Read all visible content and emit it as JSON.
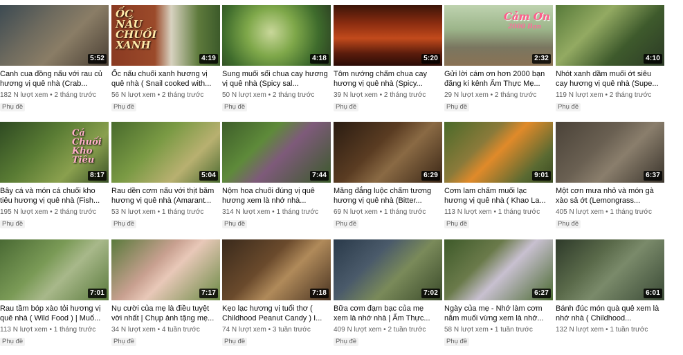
{
  "videos": [
    {
      "title": "Canh cua đồng nấu với rau củ hương vị quê nhà (Crab...",
      "views": "182 N lượt xem",
      "age": "2 tháng trước",
      "badge": "Phụ đề",
      "duration": "5:52"
    },
    {
      "title": "Ốc nấu chuối xanh hương vị quê nhà ( Snail cooked with...",
      "views": "56 N lượt xem",
      "age": "2 tháng trước",
      "badge": "Phụ đề",
      "duration": "4:19",
      "overlay": "ỐC NẤU CHUỐI XANH"
    },
    {
      "title": "Sung muối sổi chua cay hương vị quê nhà (Spicy sal...",
      "views": "50 N lượt xem",
      "age": "2 tháng trước",
      "badge": "Phụ đề",
      "duration": "4:18"
    },
    {
      "title": "Tôm nướng chấm chua cay hương vị quê nhà (Spicy...",
      "views": "39 N lượt xem",
      "age": "2 tháng trước",
      "badge": "Phụ đề",
      "duration": "5:20"
    },
    {
      "title": "Gửi lời cám ơn hơn 2000 bạn đăng kí kênh Ẩm Thực Mẹ...",
      "views": "29 N lượt xem",
      "age": "2 tháng trước",
      "badge": "Phụ đề",
      "duration": "2:32",
      "overlay": "Cảm Ơn",
      "overlay2": "2000 Bạn"
    },
    {
      "title": "Nhót xanh dầm muối ớt siêu cay hương vị quê nhà (Supe...",
      "views": "119 N lượt xem",
      "age": "2 tháng trước",
      "badge": "Phụ đề",
      "duration": "4:10"
    },
    {
      "title": "Bây cá và món cá chuối kho tiêu hương vị quê nhà (Fish...",
      "views": "195 N lượt xem",
      "age": "2 tháng trước",
      "badge": "Phụ đề",
      "duration": "8:17",
      "overlay": "Cá Chuối Kho Tiêu"
    },
    {
      "title": "Rau dền cơm nấu với thịt băm hương vị quê nhà (Amarant...",
      "views": "53 N lượt xem",
      "age": "1 tháng trước",
      "badge": "Phụ đề",
      "duration": "5:04"
    },
    {
      "title": "Nộm hoa chuối đúng vị quê hương xem là nhớ nhà...",
      "views": "314 N lượt xem",
      "age": "1 tháng trước",
      "badge": "Phụ đề",
      "duration": "7:44"
    },
    {
      "title": "Măng đắng luộc chấm tương hương vị quê nhà (Bitter...",
      "views": "69 N lượt xem",
      "age": "1 tháng trước",
      "badge": "Phụ đề",
      "duration": "6:29"
    },
    {
      "title": "Cơm lam chấm muối lạc hương vị quê nhà ( Khao La...",
      "views": "113 N lượt xem",
      "age": "1 tháng trước",
      "badge": "Phụ đề",
      "duration": "9:01"
    },
    {
      "title": "Một cơn mưa nhỏ và món gà xào sả ớt (Lemongrass...",
      "views": "405 N lượt xem",
      "age": "1 tháng trước",
      "badge": "Phụ đề",
      "duration": "6:37"
    },
    {
      "title": "Rau tầm bóp xào tỏi hương vị quê nhà ( Wild Food ) | Muố...",
      "views": "113 N lượt xem",
      "age": "1 tháng trước",
      "badge": "Phụ đề",
      "duration": "7:01"
    },
    {
      "title": "Nụ cười của mẹ là điều tuyệt vời nhất | Chụp ảnh tặng mẹ...",
      "views": "34 N lượt xem",
      "age": "4 tuần trước",
      "badge": "Phụ đề",
      "duration": "7:17"
    },
    {
      "title": "Kẹo lạc hương vị tuổi thơ ( Childhood Peanut Candy ) I...",
      "views": "74 N lượt xem",
      "age": "3 tuần trước",
      "badge": "Phụ đề",
      "duration": "7:18"
    },
    {
      "title": "Bữa cơm đạm bạc của mẹ xem là nhớ nhà | Ẩm Thực...",
      "views": "409 N lượt xem",
      "age": "2 tuần trước",
      "badge": "Phụ đề",
      "duration": "7:02"
    },
    {
      "title": "Ngày của mẹ - Nhớ làm cơm nắm muối vừng xem là nhớ...",
      "views": "58 N lượt xem",
      "age": "1 tuần trước",
      "badge": "Phụ đề",
      "duration": "6:27"
    },
    {
      "title": "Bánh đúc món quà quê xem là nhớ nhà ( Childhood...",
      "views": "132 N lượt xem",
      "age": "1 tuần trước",
      "badge": "",
      "duration": "6:01"
    }
  ],
  "meta_separator": "•"
}
